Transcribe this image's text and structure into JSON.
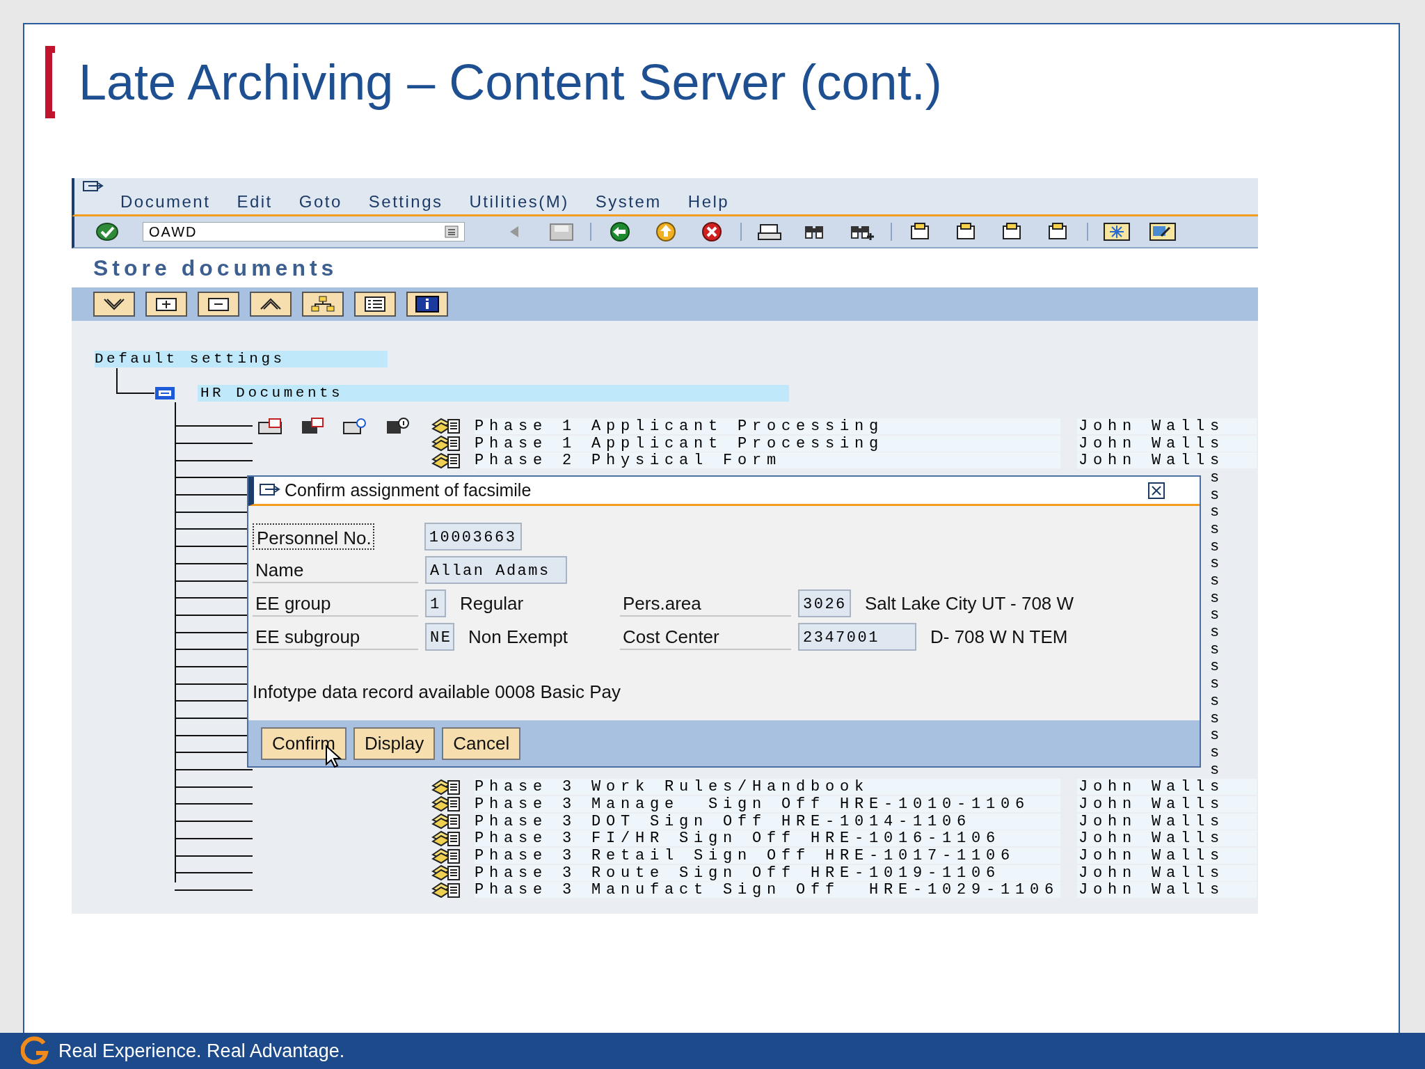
{
  "slide": {
    "title": "Late Archiving – Content Server (cont.)",
    "footer": "Real Experience. Real Advantage."
  },
  "sap": {
    "menu": [
      "Document",
      "Edit",
      "Goto",
      "Settings",
      "Utilities(M)",
      "System",
      "Help"
    ],
    "command_field": {
      "value": "OAWD"
    },
    "screen_title": "Store documents",
    "tree": {
      "label": "Default settings",
      "children": [
        {
          "label": "HR Documents",
          "rows": [
            {
              "description": "Phase 1 Applicant Processing",
              "owner": "John Walls",
              "action_icons": true
            },
            {
              "description": "Phase 1 Applicant Processing",
              "owner": "John Walls",
              "action_icons": false
            },
            {
              "description": "Phase 2 Physical Form",
              "owner": "John Walls",
              "action_icons": false
            },
            {
              "owner": "s"
            },
            {
              "owner": "s"
            },
            {
              "owner": "s"
            },
            {
              "owner": "s"
            },
            {
              "owner": "s"
            },
            {
              "owner": "s"
            },
            {
              "owner": "s"
            },
            {
              "owner": "s"
            },
            {
              "owner": "s"
            },
            {
              "owner": "s"
            },
            {
              "owner": "s"
            },
            {
              "owner": "s"
            },
            {
              "owner": "s"
            },
            {
              "owner": "s"
            },
            {
              "owner": "s"
            },
            {
              "owner": "s"
            },
            {
              "owner": "s"
            },
            {
              "owner": "s"
            },
            {
              "description": "Phase 3 Work Rules/Handbook",
              "owner": "John Walls",
              "action_icons": false
            },
            {
              "description": "Phase 3 Manage  Sign Off HRE-1010-1106",
              "owner": "John Walls",
              "action_icons": false
            },
            {
              "description": "Phase 3 DOT Sign Off HRE-1014-1106",
              "owner": "John Walls",
              "action_icons": false
            },
            {
              "description": "Phase 3 FI/HR Sign Off HRE-1016-1106",
              "owner": "John Walls",
              "action_icons": false
            },
            {
              "description": "Phase 3 Retail Sign Off HRE-1017-1106",
              "owner": "John Walls",
              "action_icons": false
            },
            {
              "description": "Phase 3 Route Sign Off HRE-1019-1106",
              "owner": "John Walls",
              "action_icons": false
            },
            {
              "description": "Phase 3 Manufact Sign Off  HRE-1029-1106",
              "owner": "John Walls",
              "action_icons": false
            }
          ]
        }
      ]
    }
  },
  "dialog": {
    "title": "Confirm assignment of facsimile",
    "fields": [
      {
        "label": "Personnel No.",
        "value": "10003663",
        "focused": true
      },
      {
        "label": "Name",
        "value": "Allan Adams",
        "focused": false
      },
      {
        "label": "EE group",
        "value": "1",
        "text": "Regular",
        "focused": false
      },
      {
        "label": "EE subgroup",
        "value": "NE",
        "text": "Non Exempt",
        "focused": false
      }
    ],
    "side_fields": [
      {
        "label": "Pers.area",
        "value": "3026",
        "text": "Salt Lake City UT - 708 W"
      },
      {
        "label": "Cost Center",
        "value": "2347001",
        "text": "D- 708 W N TEM"
      }
    ],
    "message": "Infotype data record available 0008 Basic Pay",
    "buttons": [
      "Confirm",
      "Display",
      "Cancel"
    ]
  }
}
